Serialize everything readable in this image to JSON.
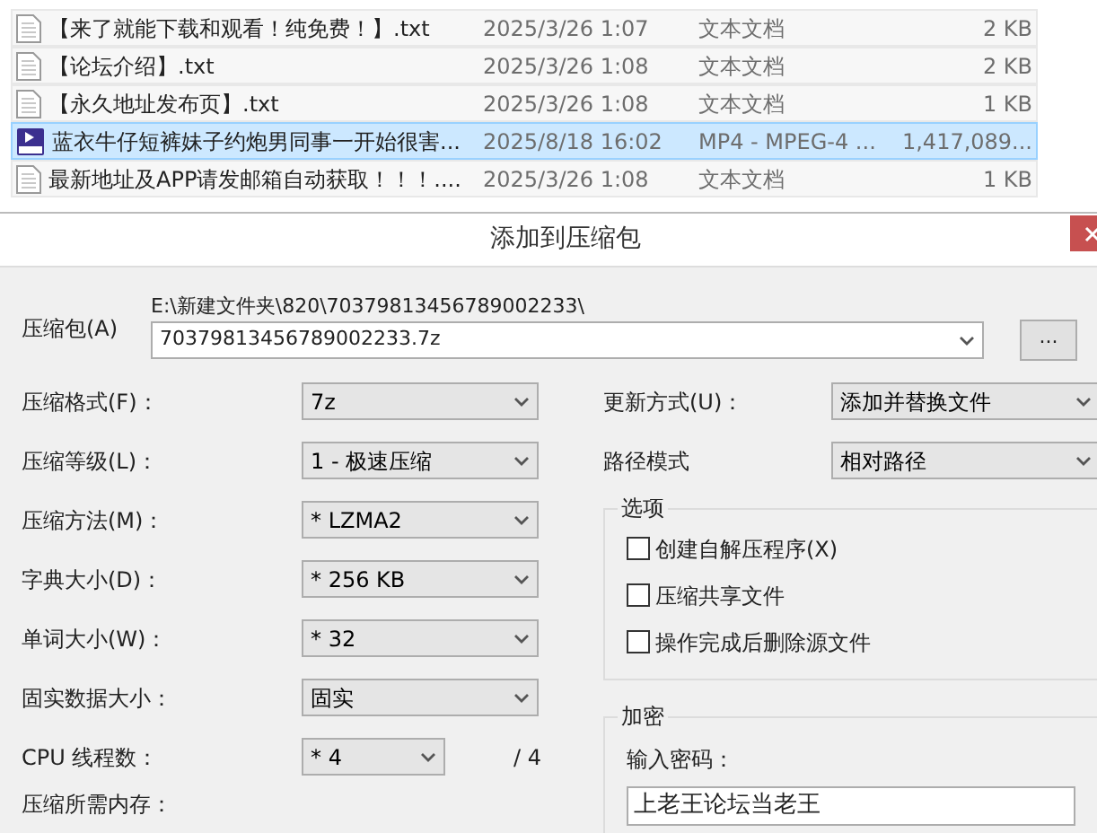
{
  "files": [
    {
      "kind": "text",
      "name": "【来了就能下载和观看！纯免费！】.txt",
      "date": "2025/3/26 1:07",
      "type": "文本文档",
      "size": "2 KB",
      "selected": false
    },
    {
      "kind": "text",
      "name": "【论坛介绍】.txt",
      "date": "2025/3/26 1:08",
      "type": "文本文档",
      "size": "2 KB",
      "selected": false
    },
    {
      "kind": "text",
      "name": "【永久地址发布页】.txt",
      "date": "2025/3/26 1:08",
      "type": "文本文档",
      "size": "1 KB",
      "selected": false
    },
    {
      "kind": "video",
      "name": "蓝衣牛仔短裤妹子约炮男同事一开始很害...",
      "date": "2025/8/18 16:02",
      "type": "MP4 - MPEG-4 ...",
      "size": "1,417,089...",
      "selected": true
    },
    {
      "kind": "text",
      "name": "最新地址及APP请发邮箱自动获取！！！....",
      "date": "2025/3/26 1:08",
      "type": "文本文档",
      "size": "1 KB",
      "selected": false
    }
  ],
  "dialog": {
    "title": "添加到压缩包",
    "archive": {
      "label": "压缩包(A)",
      "path": "E:\\新建文件夹\\820\\70379813456789002233\\",
      "value": "70379813456789002233.7z",
      "browse_button": "..."
    },
    "left_fields": [
      {
        "label": "压缩格式(F)：",
        "value": "7z"
      },
      {
        "label": "压缩等级(L)：",
        "value": "1 - 极速压缩"
      },
      {
        "label": "压缩方法(M)：",
        "value": "* LZMA2"
      },
      {
        "label": "字典大小(D)：",
        "value": "* 256 KB"
      },
      {
        "label": "单词大小(W)：",
        "value": "* 32"
      },
      {
        "label": "固实数据大小：",
        "value": "固实"
      }
    ],
    "threads": {
      "label": "CPU 线程数：",
      "value": "* 4",
      "max": "/ 4"
    },
    "memory": {
      "label": "压缩所需内存："
    },
    "right_fields": [
      {
        "label": "更新方式(U)：",
        "value": "添加并替换文件"
      },
      {
        "label": "路径模式",
        "value": "相对路径"
      }
    ],
    "options": {
      "title": "选项",
      "items": [
        {
          "label": "创建自解压程序(X)",
          "checked": false
        },
        {
          "label": "压缩共享文件",
          "checked": false
        },
        {
          "label": "操作完成后删除源文件",
          "checked": false
        }
      ]
    },
    "encryption": {
      "title": "加密",
      "password_label": "输入密码：",
      "password_value": "上老王论坛当老王"
    }
  }
}
